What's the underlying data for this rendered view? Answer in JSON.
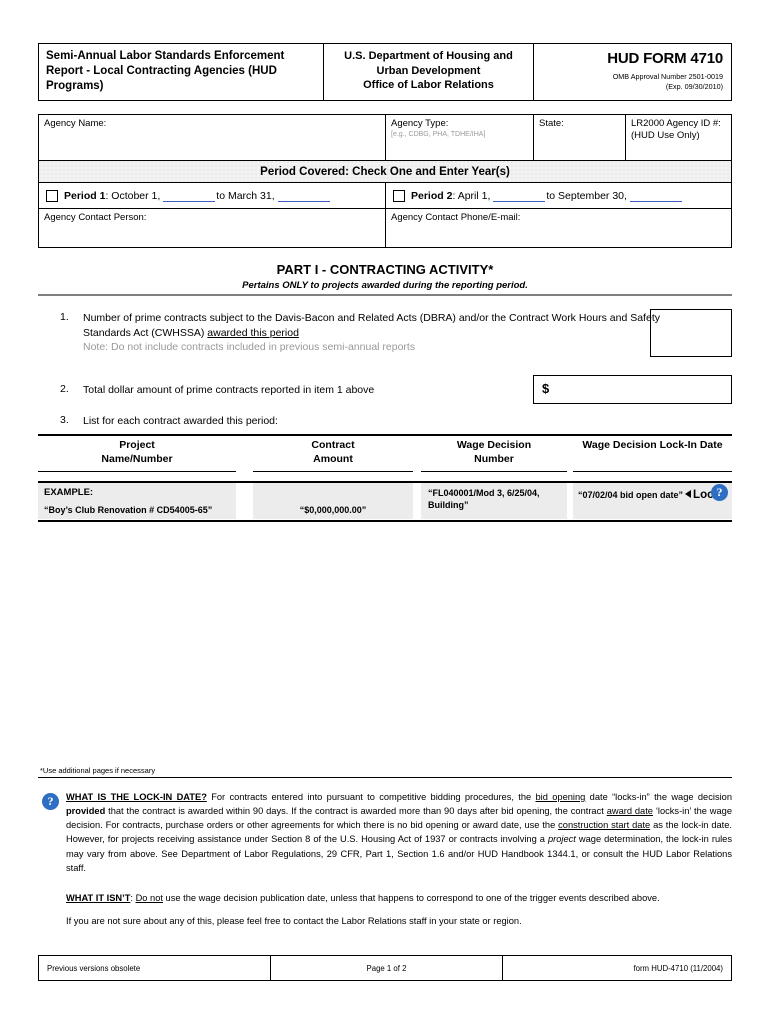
{
  "header": {
    "left_title": "Semi-Annual Labor Standards Enforcement Report - Local Contracting Agencies (HUD Programs)",
    "dept_line1": "U.S. Department of Housing and",
    "dept_line2": "Urban Development",
    "dept_line3": "Office of Labor Relations",
    "form_number": "HUD FORM 4710",
    "omb_line1": "OMB Approval Number 2501-0019",
    "omb_line2": "(Exp.  09/30/2010)"
  },
  "agency": {
    "name_label": "Agency Name:",
    "name_value": "",
    "type_label": "Agency Type:",
    "type_hint": "[e.g., CDBG, PHA, TDHE/IHA]",
    "type_value": "",
    "state_label": "State:",
    "state_value": "",
    "lr2000_label": "LR2000 Agency ID #:",
    "lr2000_sublabel": "(HUD Use Only)",
    "lr2000_value": "",
    "contact_person_label": "Agency Contact Person:",
    "contact_person_value": "",
    "contact_phone_label": "Agency Contact Phone/E-mail:",
    "contact_phone_value": ""
  },
  "period": {
    "band_title": "Period Covered:  Check One and Enter Year(s)",
    "period1_label": "Period 1",
    "period1_text_a": ": October 1,",
    "period1_text_b": "to March 31,",
    "period1_year_start": "",
    "period1_year_end": "",
    "period2_label": "Period 2",
    "period2_text_a": ": April 1,",
    "period2_text_b": "to September 30,",
    "period2_year_start": "",
    "period2_year_end": ""
  },
  "part1": {
    "title": "PART I - CONTRACTING ACTIVITY*",
    "subtitle": "Pertains ONLY to projects awarded during the reporting period.",
    "item1_number": "1.",
    "item1_text_a": "Number of prime contracts subject to the Davis-Bacon and Related Acts (DBRA) and/or the Contract Work Hours and Safety Standards Act (CWHSSA) ",
    "item1_text_underlined": "awarded this period",
    "item1_note": "Note:  Do not include contracts included in previous semi-annual reports",
    "item1_value": "",
    "item2_number": "2.",
    "item2_text": "Total dollar amount of prime contracts reported in item 1 above",
    "item2_currency": "$",
    "item2_value": "",
    "item3_number": "3.",
    "item3_text": "List for each contract awarded this period:"
  },
  "table": {
    "columns": [
      {
        "line1": "Project",
        "line2": "Name/Number"
      },
      {
        "line1": "Contract",
        "line2": "Amount"
      },
      {
        "line1": "Wage Decision",
        "line2": "Number"
      },
      {
        "line1": "Wage Decision Lock-In Date",
        "line2": ""
      }
    ],
    "example": {
      "label": "EXAMPLE:",
      "project": "“Boy’s Club Renovation # CD54005-65”",
      "amount": "“$0,000,000.00”",
      "wage_decision": "“FL040001/Mod 3, 6/25/04, Building”",
      "lock_in_date": "“07/02/04 bid open date”",
      "lock_word": "Lock"
    }
  },
  "footnote": "*Use additional pages if necessary",
  "lock_note": {
    "heading": "WHAT IS THE LOCK-IN DATE?",
    "body_1a": "  For contracts entered into pursuant to competitive bidding procedures, the ",
    "body_1b": "bid opening",
    "body_1c": " date “locks-in” the wage decision ",
    "body_1d": "provided",
    "body_1e": " that the contract is awarded within 90 days.  If the contract is awarded more than 90 days after bid opening, the contract ",
    "body_1f": "award date",
    "body_1g": " ‘locks-in’ the wage decision.  For contracts, purchase orders or other agreements for which there is no bid opening or award date, use the ",
    "body_1h": "construction start date",
    "body_1i": " as the lock-in date.  However, for projects receiving assistance under Section 8 of the U.S. Housing Act of 1937 or contracts involving a ",
    "body_1j": "project",
    "body_1k": " wage determination, the lock-in rules may vary from above.  See Department of Labor Regulations, 29 CFR, Part 1, Section 1.6 and/or HUD Handbook 1344.1, or consult the HUD Labor Relations staff.",
    "isnt_heading": "WHAT IT ISN’T",
    "isnt_a": ": ",
    "isnt_b": "Do not",
    "isnt_c": " use the wage decision publication date, unless that happens to correspond to one of the trigger events described above.",
    "closing": "If you are not sure about any of this, please feel free to contact the Labor Relations staff in your state or region."
  },
  "footer": {
    "left": "Previous versions obsolete",
    "center": "Page 1 of 2",
    "right": "form HUD-4710 (11/2004)"
  },
  "icons": {
    "help": "?"
  },
  "colors": {
    "blank_underline": "#3b5fc0",
    "help_icon": "#2e6fc4",
    "note_gray": "#999999",
    "example_shade": "#ececec"
  }
}
